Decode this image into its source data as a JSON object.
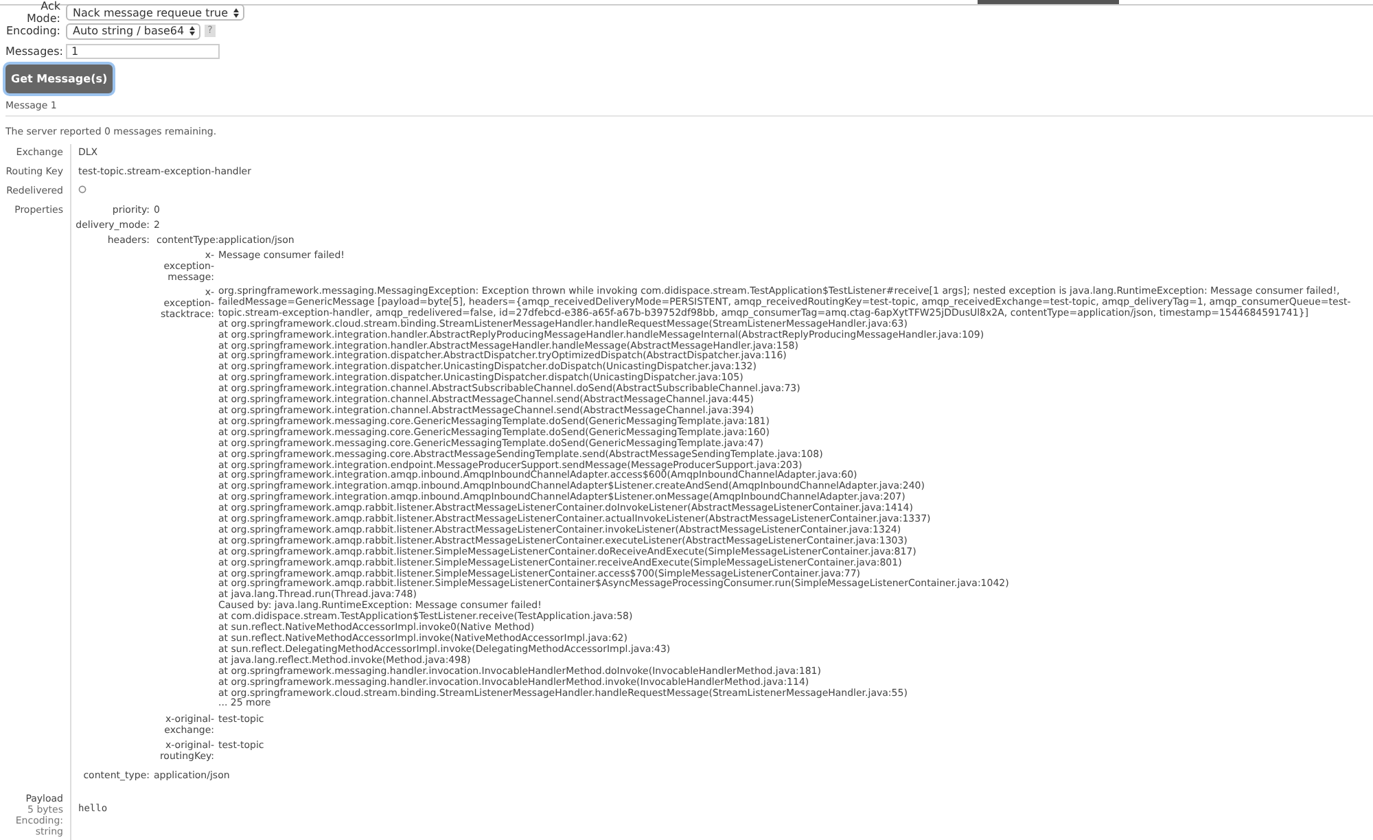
{
  "form": {
    "fields": [
      {
        "kind": "select",
        "label": "Ack Mode:",
        "value": "Nack message requeue true"
      },
      {
        "kind": "select",
        "label": "Encoding:",
        "value": "Auto string / base64",
        "help": "?"
      },
      {
        "kind": "input",
        "label": "Messages:",
        "value": "1"
      }
    ],
    "button": "Get Message(s)"
  },
  "message_heading": "Message 1",
  "summary": "The server reported 0 messages remaining.",
  "details": [
    {
      "kind": "text",
      "label": "Exchange",
      "value": "DLX"
    },
    {
      "kind": "text",
      "label": "Routing Key",
      "value": "test-topic.stream-exception-handler"
    },
    {
      "kind": "flag",
      "label": "Redelivered",
      "on": false
    },
    {
      "kind": "properties",
      "label": "Properties",
      "properties": [
        {
          "key": "priority:",
          "value": "0"
        },
        {
          "key": "delivery_mode:",
          "value": "2"
        },
        {
          "key": "headers:",
          "headers": [
            {
              "key": "contentType:",
              "value": "application/json"
            },
            {
              "key": "x-exception-message:",
              "value": "Message consumer failed!"
            },
            {
              "key": "x-exception-stacktrace:",
              "lines": [
                "org.springframework.messaging.MessagingException: Exception thrown while invoking com.didispace.stream.TestApplication$TestListener#receive[1 args]; nested exception is java.lang.RuntimeException: Message consumer failed!,",
                "failedMessage=GenericMessage [payload=byte[5], headers={amqp_receivedDeliveryMode=PERSISTENT, amqp_receivedRoutingKey=test-topic, amqp_receivedExchange=test-topic, amqp_deliveryTag=1, amqp_consumerQueue=test-topic.stream-exception-handler, amqp_redelivered=false, id=27dfebcd-e386-a65f-a67b-b39752df98bb, amqp_consumerTag=amq.ctag-6apXytTFW25jDDusUl8x2A, contentType=application/json, timestamp=1544684591741}]",
                "at org.springframework.cloud.stream.binding.StreamListenerMessageHandler.handleRequestMessage(StreamListenerMessageHandler.java:63)",
                "at org.springframework.integration.handler.AbstractReplyProducingMessageHandler.handleMessageInternal(AbstractReplyProducingMessageHandler.java:109)",
                "at org.springframework.integration.handler.AbstractMessageHandler.handleMessage(AbstractMessageHandler.java:158)",
                "at org.springframework.integration.dispatcher.AbstractDispatcher.tryOptimizedDispatch(AbstractDispatcher.java:116)",
                "at org.springframework.integration.dispatcher.UnicastingDispatcher.doDispatch(UnicastingDispatcher.java:132)",
                "at org.springframework.integration.dispatcher.UnicastingDispatcher.dispatch(UnicastingDispatcher.java:105)",
                "at org.springframework.integration.channel.AbstractSubscribableChannel.doSend(AbstractSubscribableChannel.java:73)",
                "at org.springframework.integration.channel.AbstractMessageChannel.send(AbstractMessageChannel.java:445)",
                "at org.springframework.integration.channel.AbstractMessageChannel.send(AbstractMessageChannel.java:394)",
                "at org.springframework.messaging.core.GenericMessagingTemplate.doSend(GenericMessagingTemplate.java:181)",
                "at org.springframework.messaging.core.GenericMessagingTemplate.doSend(GenericMessagingTemplate.java:160)",
                "at org.springframework.messaging.core.GenericMessagingTemplate.doSend(GenericMessagingTemplate.java:47)",
                "at org.springframework.messaging.core.AbstractMessageSendingTemplate.send(AbstractMessageSendingTemplate.java:108)",
                "at org.springframework.integration.endpoint.MessageProducerSupport.sendMessage(MessageProducerSupport.java:203)",
                "at org.springframework.integration.amqp.inbound.AmqpInboundChannelAdapter.access$600(AmqpInboundChannelAdapter.java:60)",
                "at org.springframework.integration.amqp.inbound.AmqpInboundChannelAdapter$Listener.createAndSend(AmqpInboundChannelAdapter.java:240)",
                "at org.springframework.integration.amqp.inbound.AmqpInboundChannelAdapter$Listener.onMessage(AmqpInboundChannelAdapter.java:207)",
                "at org.springframework.amqp.rabbit.listener.AbstractMessageListenerContainer.doInvokeListener(AbstractMessageListenerContainer.java:1414)",
                "at org.springframework.amqp.rabbit.listener.AbstractMessageListenerContainer.actualInvokeListener(AbstractMessageListenerContainer.java:1337)",
                "at org.springframework.amqp.rabbit.listener.AbstractMessageListenerContainer.invokeListener(AbstractMessageListenerContainer.java:1324)",
                "at org.springframework.amqp.rabbit.listener.AbstractMessageListenerContainer.executeListener(AbstractMessageListenerContainer.java:1303)",
                "at org.springframework.amqp.rabbit.listener.SimpleMessageListenerContainer.doReceiveAndExecute(SimpleMessageListenerContainer.java:817)",
                "at org.springframework.amqp.rabbit.listener.SimpleMessageListenerContainer.receiveAndExecute(SimpleMessageListenerContainer.java:801)",
                "at org.springframework.amqp.rabbit.listener.SimpleMessageListenerContainer.access$700(SimpleMessageListenerContainer.java:77)",
                "at org.springframework.amqp.rabbit.listener.SimpleMessageListenerContainer$AsyncMessageProcessingConsumer.run(SimpleMessageListenerContainer.java:1042)",
                "at java.lang.Thread.run(Thread.java:748)",
                "Caused by: java.lang.RuntimeException: Message consumer failed!",
                "at com.didispace.stream.TestApplication$TestListener.receive(TestApplication.java:58)",
                "at sun.reflect.NativeMethodAccessorImpl.invoke0(Native Method)",
                "at sun.reflect.NativeMethodAccessorImpl.invoke(NativeMethodAccessorImpl.java:62)",
                "at sun.reflect.DelegatingMethodAccessorImpl.invoke(DelegatingMethodAccessorImpl.java:43)",
                "at java.lang.reflect.Method.invoke(Method.java:498)",
                "at org.springframework.messaging.handler.invocation.InvocableHandlerMethod.doInvoke(InvocableHandlerMethod.java:181)",
                "at org.springframework.messaging.handler.invocation.InvocableHandlerMethod.invoke(InvocableHandlerMethod.java:114)",
                "at org.springframework.cloud.stream.binding.StreamListenerMessageHandler.handleRequestMessage(StreamListenerMessageHandler.java:55)",
                "... 25 more"
              ]
            },
            {
              "key": "x-original-exchange:",
              "value": "test-topic"
            },
            {
              "key": "x-original-routingKey:",
              "value": "test-topic"
            }
          ]
        },
        {
          "key": "content_type:",
          "value": "application/json"
        }
      ]
    },
    {
      "kind": "payload",
      "label": "Payload",
      "notes": [
        "5 bytes",
        "Encoding:",
        "string"
      ],
      "value": "hello"
    }
  ]
}
